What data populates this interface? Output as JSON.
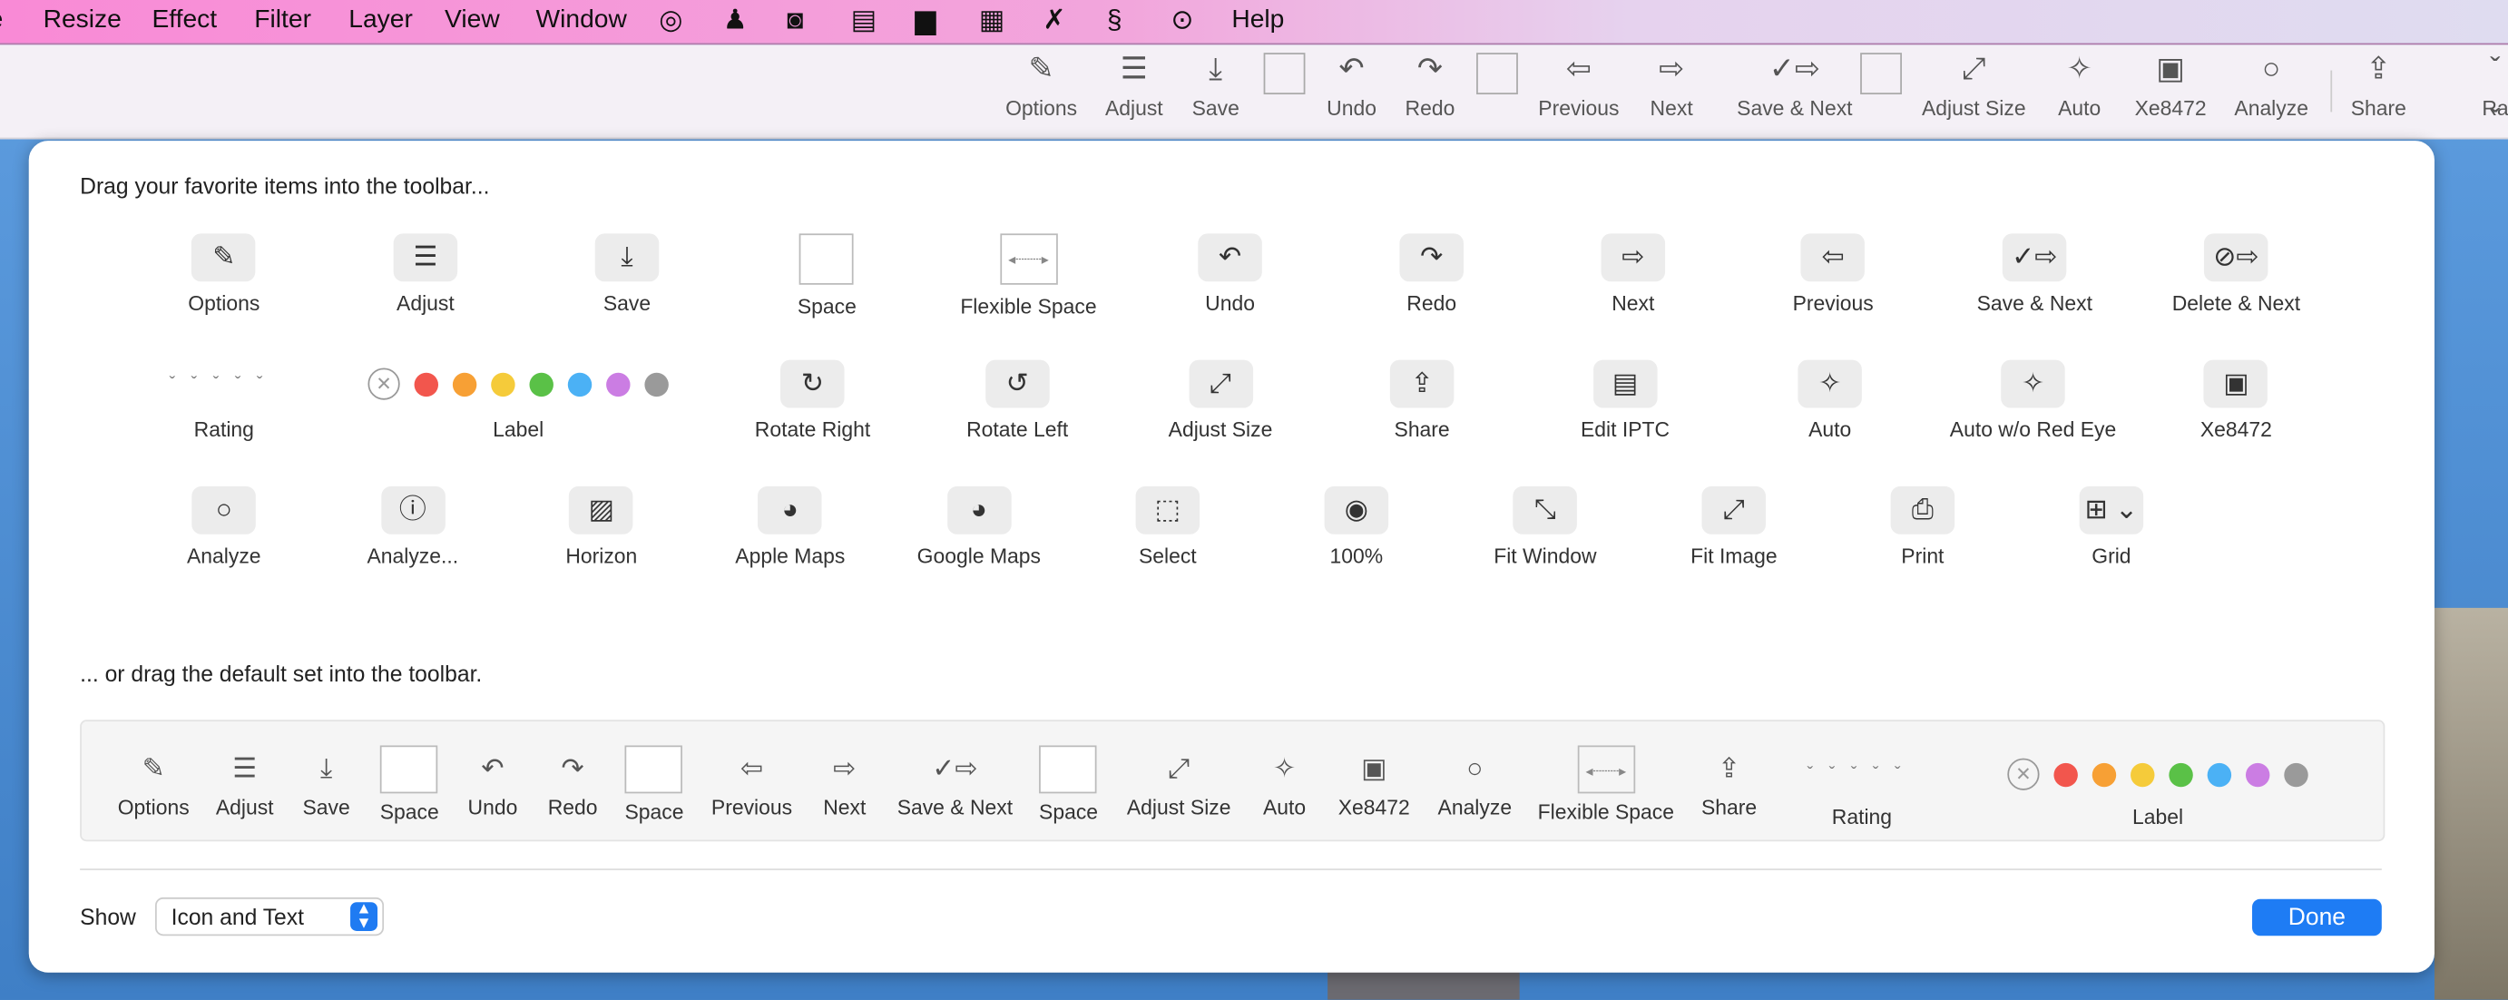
{
  "menubar": {
    "items": [
      "e",
      "Resize",
      "Effect",
      "Filter",
      "Layer",
      "View",
      "Window"
    ],
    "icons": [
      "target-icon",
      "person-icon",
      "camera-icon",
      "clipboard-icon",
      "package-icon",
      "calendar-icon",
      "pin-icon",
      "dollar-icon",
      "ellipsis-circle-icon"
    ],
    "help": "Help"
  },
  "toolbar": {
    "items": [
      {
        "label": "Options",
        "icon": "options"
      },
      {
        "label": "Adjust",
        "icon": "adjust"
      },
      {
        "label": "Save",
        "icon": "save"
      },
      {
        "label": "",
        "icon": "space"
      },
      {
        "label": "Undo",
        "icon": "undo"
      },
      {
        "label": "Redo",
        "icon": "redo"
      },
      {
        "label": "",
        "icon": "space"
      },
      {
        "label": "Previous",
        "icon": "previous"
      },
      {
        "label": "Next",
        "icon": "next"
      },
      {
        "label": "Save & Next",
        "icon": "save-next"
      },
      {
        "label": "",
        "icon": "space"
      },
      {
        "label": "Adjust Size",
        "icon": "adjust-size"
      },
      {
        "label": "Auto",
        "icon": "auto"
      },
      {
        "label": "Xe8472",
        "icon": "image"
      },
      {
        "label": "Analyze",
        "icon": "analyze"
      },
      {
        "label": "Share",
        "icon": "share"
      },
      {
        "label": "Ra",
        "icon": "rating"
      }
    ]
  },
  "sheet": {
    "heading": "Drag your favorite items into the toolbar...",
    "rows": [
      [
        {
          "label": "Options",
          "icon": "options"
        },
        {
          "label": "Adjust",
          "icon": "adjust"
        },
        {
          "label": "Save",
          "icon": "save"
        },
        {
          "label": "Space",
          "icon": "space"
        },
        {
          "label": "Flexible Space",
          "icon": "flexible-space"
        },
        {
          "label": "Undo",
          "icon": "undo"
        },
        {
          "label": "Redo",
          "icon": "redo"
        },
        {
          "label": "Next",
          "icon": "next"
        },
        {
          "label": "Previous",
          "icon": "previous"
        },
        {
          "label": "Save & Next",
          "icon": "save-next"
        },
        {
          "label": "Delete & Next",
          "icon": "delete-next"
        }
      ],
      [
        {
          "label": "Rating",
          "icon": "rating"
        },
        {
          "label": "Label",
          "icon": "label"
        },
        {
          "label": "Rotate Right",
          "icon": "rotate-right"
        },
        {
          "label": "Rotate Left",
          "icon": "rotate-left"
        },
        {
          "label": "Adjust Size",
          "icon": "adjust-size"
        },
        {
          "label": "Share",
          "icon": "share"
        },
        {
          "label": "Edit IPTC",
          "icon": "edit-iptc"
        },
        {
          "label": "Auto",
          "icon": "auto"
        },
        {
          "label": "Auto w/o Red Eye",
          "icon": "auto-no-red-eye"
        },
        {
          "label": "Xe8472",
          "icon": "image"
        }
      ],
      [
        {
          "label": "Analyze",
          "icon": "analyze"
        },
        {
          "label": "Analyze...",
          "icon": "analyze-alert"
        },
        {
          "label": "Horizon",
          "icon": "horizon"
        },
        {
          "label": "Apple Maps",
          "icon": "globe"
        },
        {
          "label": "Google Maps",
          "icon": "globe"
        },
        {
          "label": "Select",
          "icon": "select"
        },
        {
          "label": "100%",
          "icon": "eye"
        },
        {
          "label": "Fit Window",
          "icon": "fit-window"
        },
        {
          "label": "Fit Image",
          "icon": "fit-image"
        },
        {
          "label": "Print",
          "icon": "print"
        },
        {
          "label": "Grid",
          "icon": "grid"
        }
      ]
    ],
    "default_heading": "... or drag the default set into the toolbar.",
    "default_set": [
      {
        "label": "Options",
        "icon": "options"
      },
      {
        "label": "Adjust",
        "icon": "adjust"
      },
      {
        "label": "Save",
        "icon": "save"
      },
      {
        "label": "Space",
        "icon": "space"
      },
      {
        "label": "Undo",
        "icon": "undo"
      },
      {
        "label": "Redo",
        "icon": "redo"
      },
      {
        "label": "Space",
        "icon": "space"
      },
      {
        "label": "Previous",
        "icon": "previous"
      },
      {
        "label": "Next",
        "icon": "next"
      },
      {
        "label": "Save & Next",
        "icon": "save-next"
      },
      {
        "label": "Space",
        "icon": "space"
      },
      {
        "label": "Adjust Size",
        "icon": "adjust-size"
      },
      {
        "label": "Auto",
        "icon": "auto"
      },
      {
        "label": "Xe8472",
        "icon": "image"
      },
      {
        "label": "Analyze",
        "icon": "analyze"
      },
      {
        "label": "Flexible Space",
        "icon": "flexible-space"
      },
      {
        "label": "Share",
        "icon": "share"
      },
      {
        "label": "Rating",
        "icon": "rating"
      },
      {
        "label": "Label",
        "icon": "label"
      }
    ],
    "label_colors": [
      "#f2564d",
      "#f7a035",
      "#f5cb3a",
      "#5ac147",
      "#4bb1f5",
      "#cb7de3",
      "#9a9a9a"
    ],
    "show_label": "Show",
    "show_value": "Icon and Text",
    "done": "Done",
    "accent": "#1e7cf4"
  }
}
